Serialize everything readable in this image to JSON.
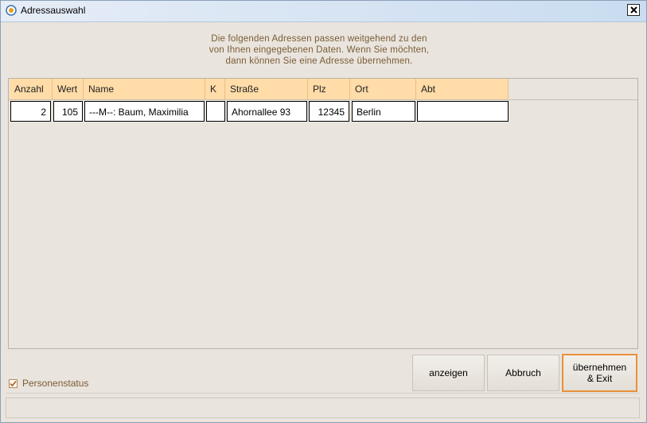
{
  "window": {
    "title": "Adressauswahl"
  },
  "message": {
    "lines": [
      "Die folgenden Adressen passen weitgehend zu den",
      "von Ihnen eingegebenen Daten. Wenn Sie möchten,",
      "dann können Sie eine Adresse übernehmen."
    ]
  },
  "table": {
    "columns": [
      "Anzahl",
      "Wert",
      "Name",
      "K",
      "Straße",
      "Plz",
      "Ort",
      "Abt"
    ],
    "rows": [
      {
        "anzahl": "2",
        "wert": "105",
        "name": "---M--: Baum, Maximilia",
        "k": "",
        "strasse": "Ahornallee 93",
        "plz": "12345",
        "ort": "Berlin",
        "abt": ""
      }
    ]
  },
  "options": {
    "personenstatus_label": "Personenstatus",
    "personenstatus_checked": true
  },
  "buttons": {
    "anzeigen": "anzeigen",
    "abbruch": "Abbruch",
    "uebernehmen_line1": "übernehmen",
    "uebernehmen_line2": "& Exit"
  },
  "colors": {
    "header_bg": "#ffdca8",
    "default_button_border": "#e8913a",
    "message_text": "#7a5c36"
  }
}
